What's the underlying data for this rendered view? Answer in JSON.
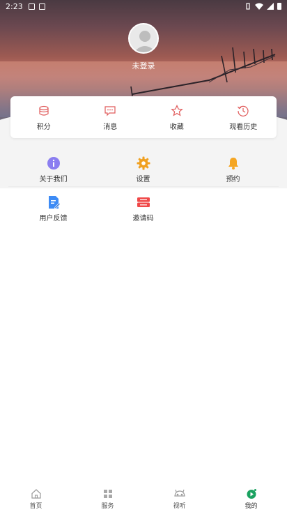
{
  "status_bar": {
    "time": "2:23"
  },
  "profile": {
    "username": "未登录"
  },
  "quick_actions": [
    {
      "label": "积分",
      "icon": "points-icon"
    },
    {
      "label": "消息",
      "icon": "message-icon"
    },
    {
      "label": "收藏",
      "icon": "star-icon"
    },
    {
      "label": "观看历史",
      "icon": "history-icon"
    }
  ],
  "menu": [
    {
      "label": "关于我们",
      "icon": "info-icon",
      "color": "#8b7ef0"
    },
    {
      "label": "设置",
      "icon": "gear-icon",
      "color": "#f0a020"
    },
    {
      "label": "预约",
      "icon": "bell-icon",
      "color": "#f5a623"
    },
    {
      "label": "用户反馈",
      "icon": "feedback-icon",
      "color": "#3d8bf5"
    },
    {
      "label": "邀请码",
      "icon": "ticket-icon",
      "color": "#f04848"
    }
  ],
  "bottom_nav": [
    {
      "label": "首页",
      "icon": "home-icon",
      "active": false
    },
    {
      "label": "服务",
      "icon": "grid-icon",
      "active": false
    },
    {
      "label": "视听",
      "icon": "media-icon",
      "active": false
    },
    {
      "label": "我的",
      "icon": "profile-play-icon",
      "active": true
    }
  ],
  "colors": {
    "accent": "#e05a5a",
    "active_nav": "#1aa260"
  }
}
